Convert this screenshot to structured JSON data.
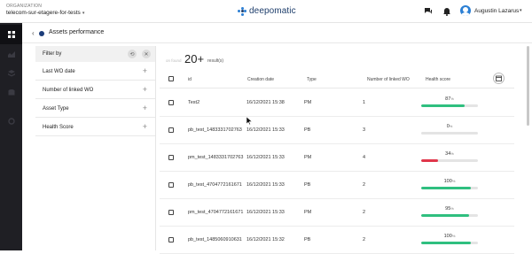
{
  "header": {
    "org_label": "ORGANIZATION",
    "org_name": "telecom-sur-etagere-for-tests",
    "logo_text": "deepomatic",
    "user_name": "Augustin Lazarus",
    "icons": [
      "chat-icon",
      "bell-icon",
      "user-avatar-icon",
      "chevron-down-icon"
    ]
  },
  "rail": {
    "items": [
      {
        "name": "dashboard-grid-icon",
        "active": true
      },
      {
        "name": "chart-icon",
        "active": false
      },
      {
        "name": "layers-icon",
        "active": false
      },
      {
        "name": "database-icon",
        "active": false
      },
      {
        "name": "settings-icon",
        "active": false
      }
    ]
  },
  "page": {
    "title": "Assets performance"
  },
  "filters": {
    "title": "Filter by",
    "items": [
      "Last WO date",
      "Number of linked WO",
      "Asset Type",
      "Health Score"
    ]
  },
  "results": {
    "muted_label": "on found",
    "count": "20+",
    "unit": "result(s)"
  },
  "table": {
    "columns": [
      "id",
      "Creation date",
      "Type",
      "Number of linked WO",
      "Health score"
    ],
    "rows": [
      {
        "id": "Test2",
        "date": "16/12/2021 15:38",
        "type": "PM",
        "linked": "1",
        "score": 87,
        "color": "#2fbf7f",
        "pct": "%"
      },
      {
        "id": "pb_test_1483331702763",
        "date": "16/12/2021 15:33",
        "type": "PB",
        "linked": "3",
        "score": 0,
        "color": "#2fbf7f",
        "pct": "%"
      },
      {
        "id": "pm_test_1483331702763",
        "date": "16/12/2021 15:33",
        "type": "PM",
        "linked": "4",
        "score": 34,
        "color": "#e0364a",
        "pct": "%"
      },
      {
        "id": "pb_test_4704772161671",
        "date": "16/12/2021 15:33",
        "type": "PB",
        "linked": "2",
        "score": 100,
        "color": "#2fbf7f",
        "pct": "%"
      },
      {
        "id": "pm_test_4704772161671",
        "date": "16/12/2021 15:33",
        "type": "PM",
        "linked": "2",
        "score": 95,
        "color": "#2fbf7f",
        "pct": "%"
      },
      {
        "id": "pb_test_1485060910631",
        "date": "16/12/2021 15:32",
        "type": "PB",
        "linked": "2",
        "score": 100,
        "color": "#2fbf7f",
        "pct": "%"
      }
    ]
  },
  "colors": {
    "rail_bg": "#1f1f24",
    "brand_blue": "#2b7fd4",
    "logo_navy": "#1d3d6b",
    "good": "#2fbf7f",
    "bad": "#e0364a"
  }
}
